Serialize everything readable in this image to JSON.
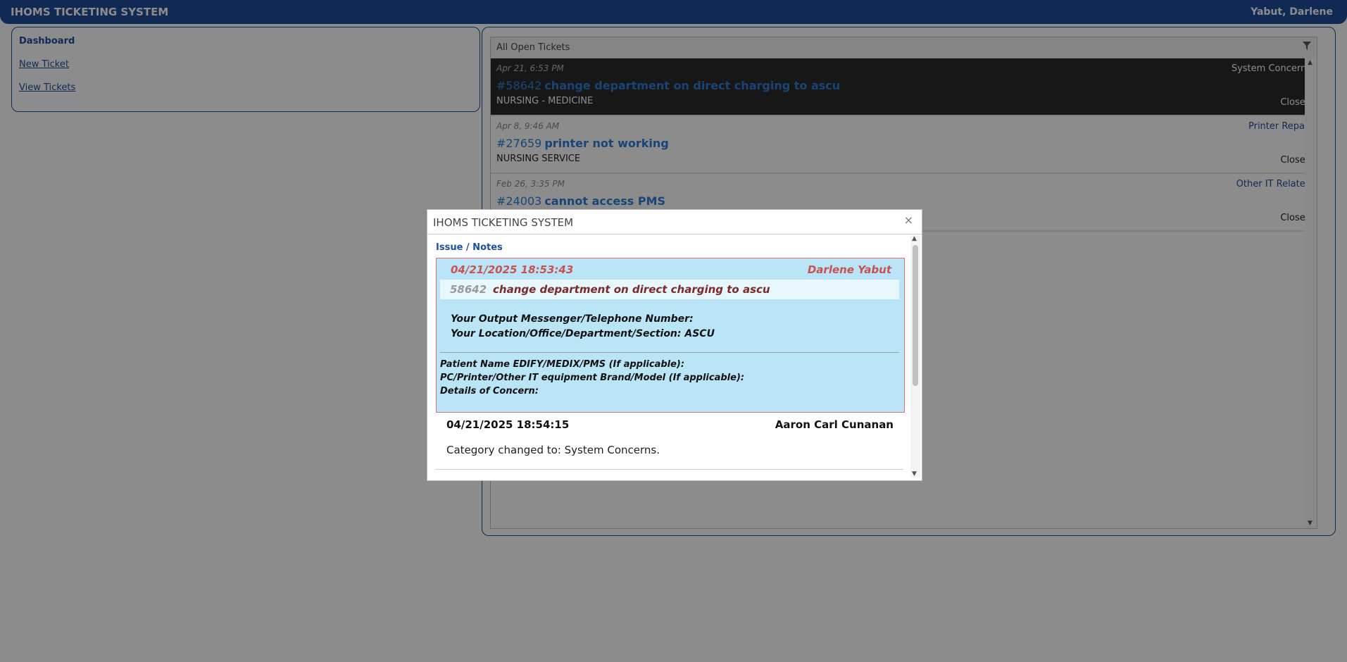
{
  "header": {
    "app_title": "IHOMS TICKETING SYSTEM",
    "user": "Yabut, Darlene"
  },
  "sidebar": {
    "items": [
      {
        "label": "Dashboard"
      },
      {
        "label": "New Ticket"
      },
      {
        "label": "View Tickets"
      }
    ]
  },
  "tickets": {
    "header_label": "All Open Tickets",
    "filter_icon": "filter-icon",
    "rows": [
      {
        "date": "Apr 21, 6:53 PM",
        "category": "System Concerns",
        "number": "#58642",
        "title": "change department on direct charging to ascu",
        "department": "NURSING - MEDICINE",
        "status": "Closed"
      },
      {
        "date": "Apr 8, 9:46 AM",
        "category": "Printer Repair",
        "number": "#27659",
        "title": "printer not working",
        "department": "NURSING SERVICE",
        "status": "Closed"
      },
      {
        "date": "Feb 26, 3:35 PM",
        "category": "Other IT Related",
        "number": "#24003",
        "title": "cannot access PMS",
        "department": "",
        "status": "Closed"
      }
    ]
  },
  "dialog": {
    "title": "IHOMS TICKETING SYSTEM",
    "close_glyph": "×",
    "section_label": "Issue / Notes",
    "note": {
      "date": "04/21/2025 18:53:43",
      "author": "Darlene Yabut",
      "id": "58642",
      "subject": "change department on direct charging to ascu",
      "line1": "Your Output Messenger/Telephone Number:",
      "line2": "Your Location/Office/Department/Section: ASCU",
      "small1": "Patient Name EDIFY/MEDIX/PMS (If applicable):",
      "small2": "PC/Printer/Other IT equipment Brand/Model (If applicable):",
      "small3": "Details of Concern:"
    },
    "log": {
      "date": "04/21/2025 18:54:15",
      "author": "Aaron Carl Cunanan",
      "text": "Category changed to: System Concerns."
    }
  },
  "colors": {
    "accent": "#1f4e9c",
    "link": "#2f7fd8",
    "note_bg": "#b9e5f7",
    "note_border": "#e07070"
  }
}
